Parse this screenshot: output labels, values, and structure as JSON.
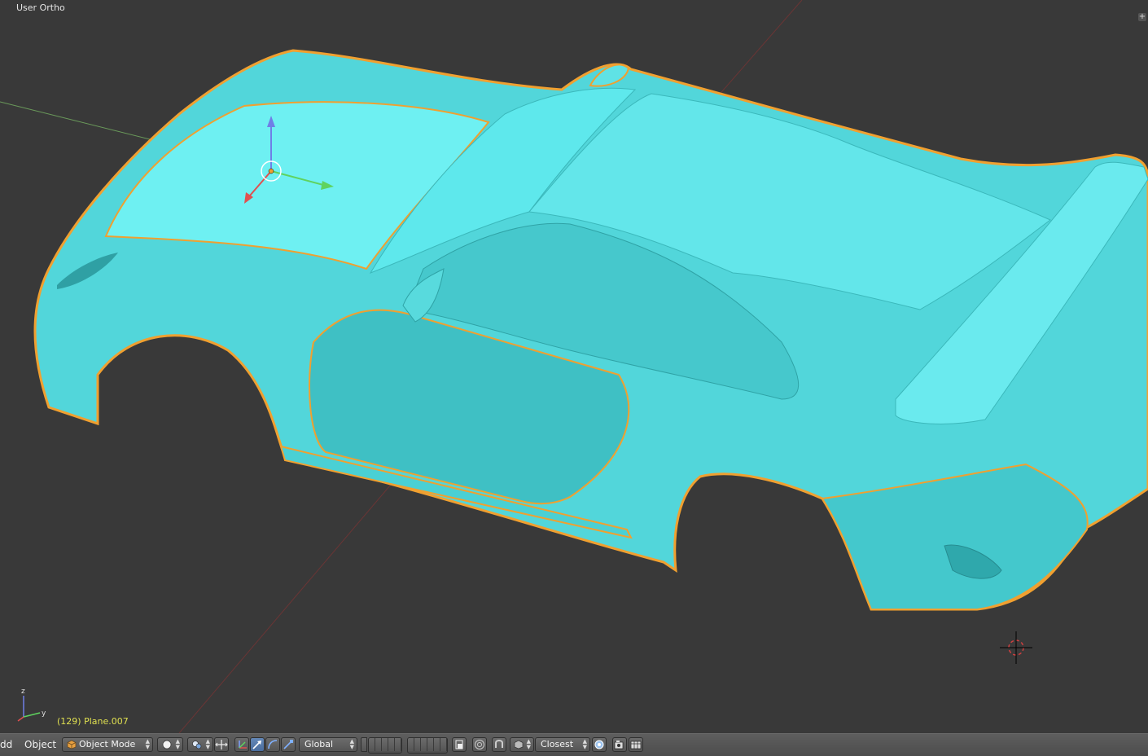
{
  "viewport": {
    "title": "User Ortho",
    "object_info": "(129) Plane.007",
    "mini_axes": {
      "z": "z",
      "y": "y"
    }
  },
  "header": {
    "menu": [
      "dd",
      "Object"
    ],
    "mode": "Object Mode",
    "orientation": "Global",
    "snap_target": "Closest"
  },
  "colors": {
    "viewport_bg": "#393939",
    "car_body": "#4fe3e6",
    "selection_outline": "#f0a030",
    "header_bg": "#555555"
  },
  "icons": [
    "cube-icon",
    "viewport-shading-icon",
    "pivot-point-icon",
    "manipulator-toggle-icon",
    "translate-manipulator-icon",
    "rotate-manipulator-icon",
    "scale-manipulator-icon",
    "layers-icon",
    "layer-lock-icon",
    "proportional-edit-icon",
    "snap-icon",
    "snap-element-icon",
    "onion-icon",
    "render-camera-icon",
    "render-animation-icon",
    "3d-cursor-icon"
  ]
}
